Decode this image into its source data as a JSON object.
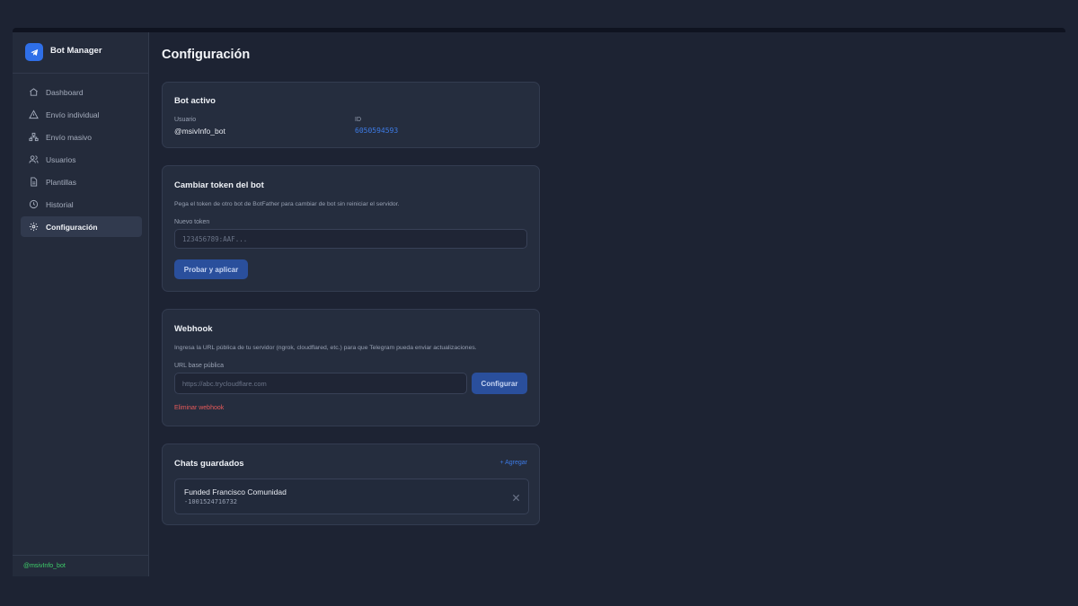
{
  "app": {
    "name": "Bot Manager",
    "footer_user": "@msivInfo_bot",
    "colors": {
      "accent": "#2f6fe8",
      "online": "#3ecf6a",
      "danger": "#e85a5a"
    }
  },
  "sidebar": {
    "items": [
      {
        "label": "Dashboard",
        "icon": "home-icon"
      },
      {
        "label": "Envío individual",
        "icon": "send-icon"
      },
      {
        "label": "Envío masivo",
        "icon": "broadcast-icon"
      },
      {
        "label": "Usuarios",
        "icon": "users-icon"
      },
      {
        "label": "Plantillas",
        "icon": "template-icon"
      },
      {
        "label": "Historial",
        "icon": "clock-icon"
      },
      {
        "label": "Configuración",
        "icon": "gear-icon",
        "active": true
      }
    ]
  },
  "page": {
    "title": "Configuración"
  },
  "bot_card": {
    "title": "Bot activo",
    "user_label": "Usuario",
    "user_value": "@msivInfo_bot",
    "id_label": "ID",
    "id_value": "6050594593"
  },
  "token_card": {
    "title": "Cambiar token del bot",
    "description": "Pega el token de otro bot de BotFather para cambiar de bot sin reiniciar el servidor.",
    "field_label": "Nuevo token",
    "placeholder": "123456789:AAF...",
    "button": "Probar y aplicar"
  },
  "webhook_card": {
    "title": "Webhook",
    "description": "Ingresa la URL pública de tu servidor (ngrok, cloudflared, etc.) para que Telegram pueda enviar actualizaciones.",
    "field_label": "URL base pública",
    "placeholder": "https://abc.trycloudflare.com",
    "button": "Configurar",
    "delete_link": "Eliminar webhook"
  },
  "chats_card": {
    "title": "Chats guardados",
    "add_link": "+ Agregar",
    "chats": [
      {
        "name": "Funded Francisco Comunidad",
        "id": "-1001524716732"
      }
    ]
  }
}
